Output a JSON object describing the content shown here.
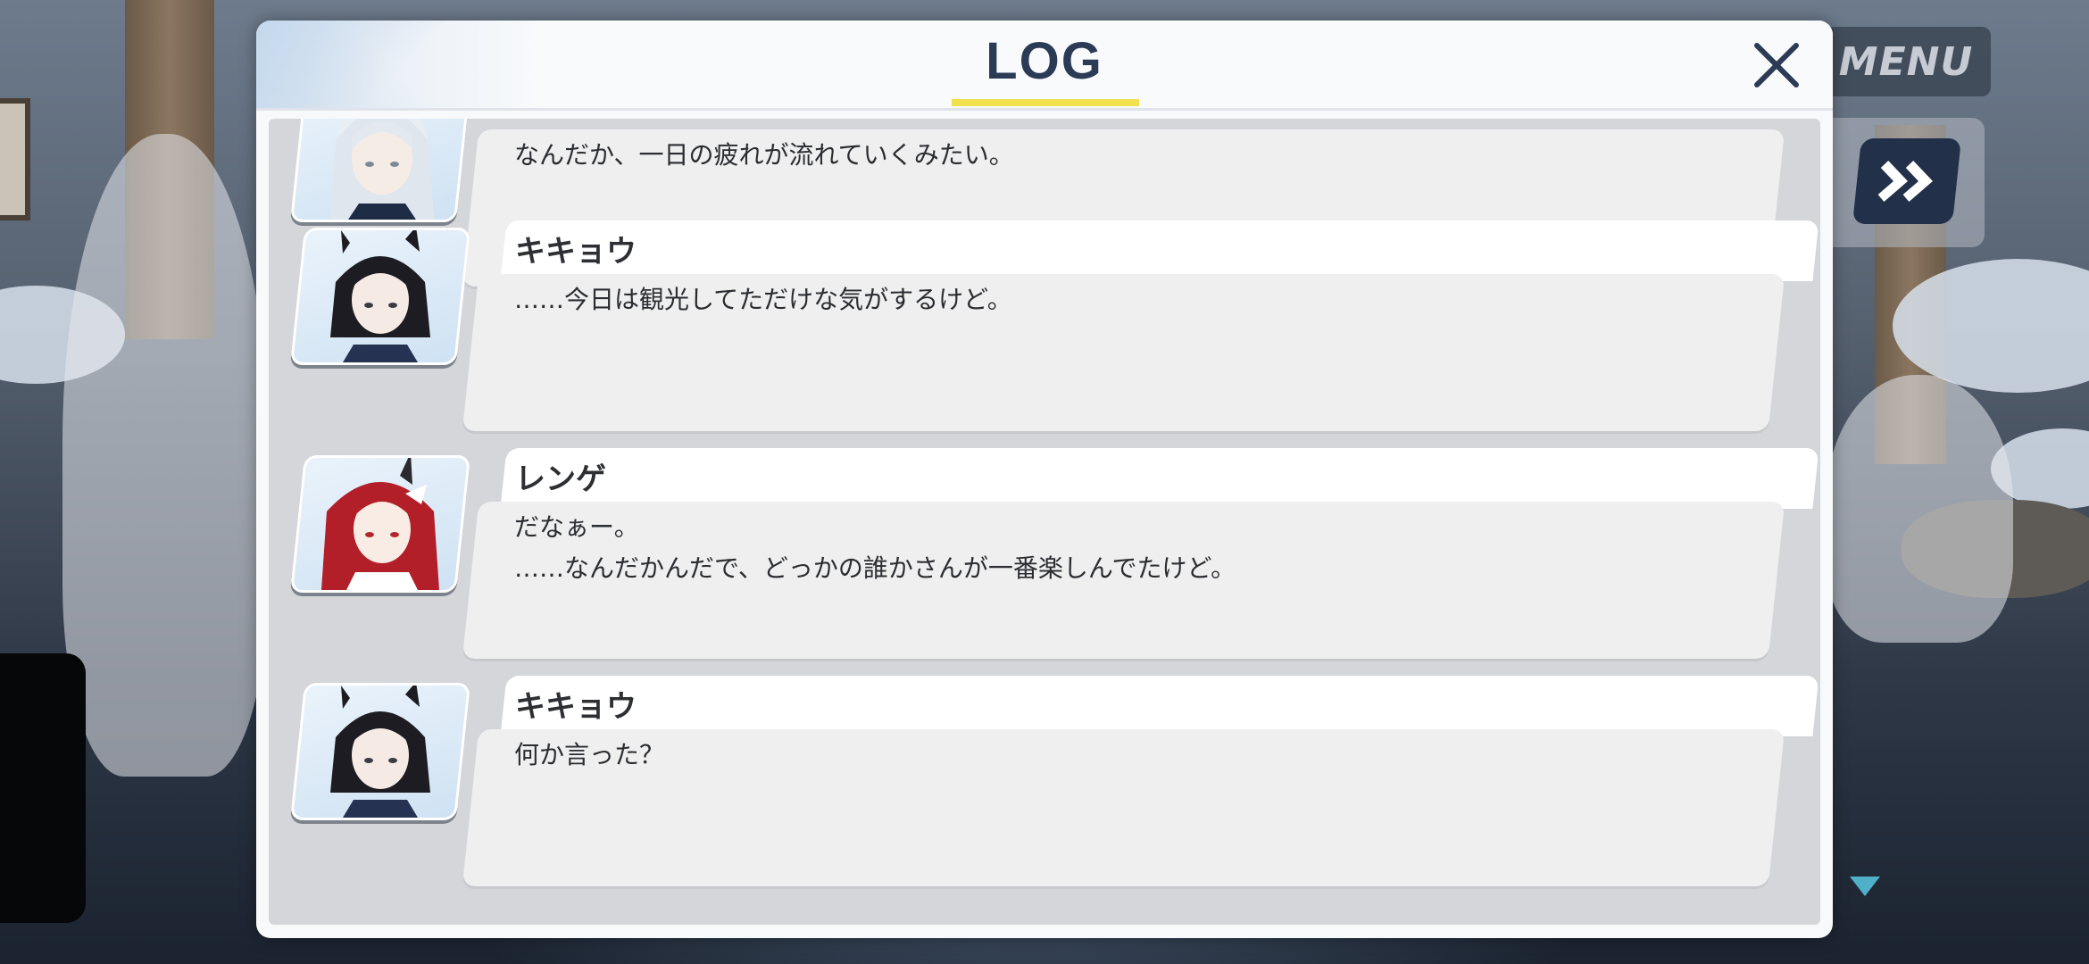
{
  "hud": {
    "menu_label": "MENU",
    "fast_forward_icon": "double-chevron-right-icon"
  },
  "log": {
    "title": "LOG",
    "close_icon": "close-icon",
    "entries": [
      {
        "speaker": "",
        "portrait": "white-haired-girl-portrait",
        "text": "なんだか、一日の疲れが流れていくみたい。"
      },
      {
        "speaker": "キキョウ",
        "portrait": "kikyou-portrait",
        "text": "……今日は観光してただけな気がするけど。"
      },
      {
        "speaker": "レンゲ",
        "portrait": "renge-portrait",
        "text": "だなぁー。\n……なんだかんだで、どっかの誰かさんが一番楽しんでたけど。"
      },
      {
        "speaker": "キキョウ",
        "portrait": "kikyou-portrait",
        "text": "何か言った？"
      }
    ]
  },
  "colors": {
    "title": "#2b3b55",
    "underline": "#f2e14e",
    "advance_indicator": "#4fb0c8"
  }
}
